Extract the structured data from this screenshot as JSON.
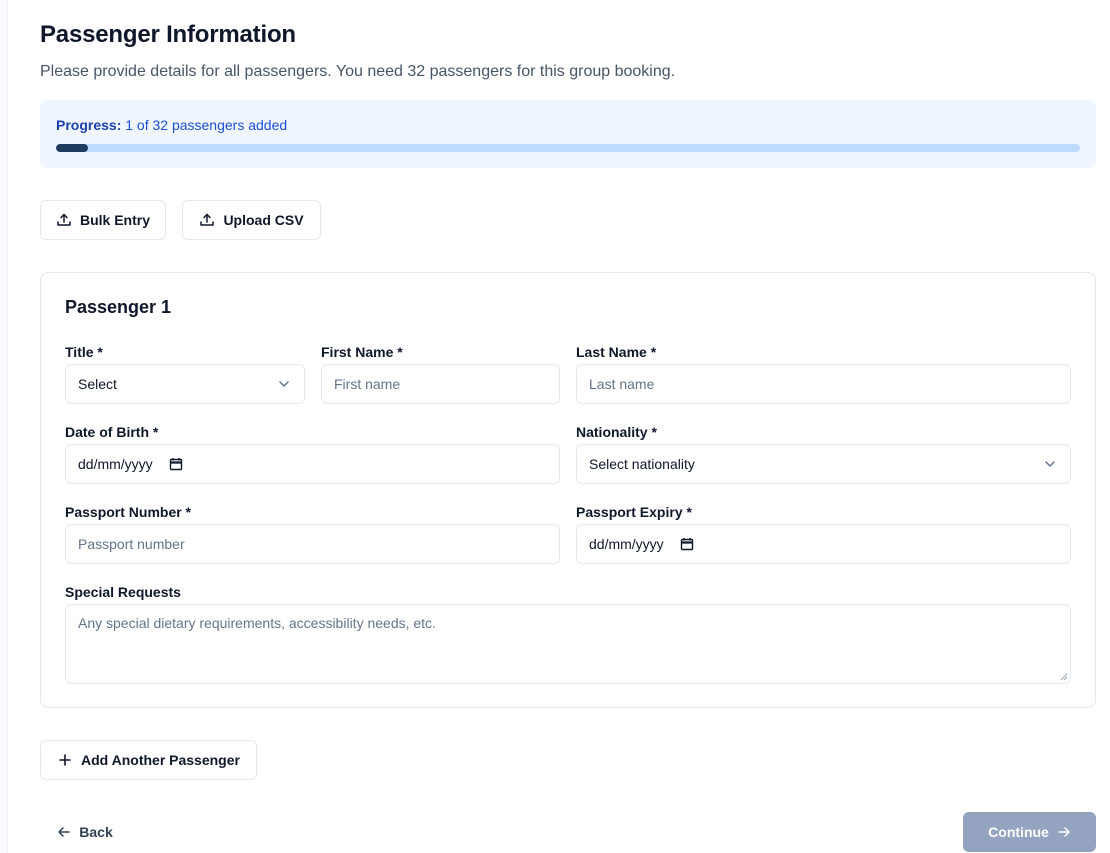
{
  "header": {
    "title": "Passenger Information",
    "subtitle": "Please provide details for all passengers. You need 32 passengers for this group booking."
  },
  "progress": {
    "label": "Progress:",
    "text": "1 of 32 passengers added",
    "added": 1,
    "total": 32
  },
  "actions": {
    "bulk_entry": "Bulk Entry",
    "upload_csv": "Upload CSV",
    "add_passenger": "Add Another Passenger",
    "back": "Back",
    "continue": "Continue"
  },
  "passenger": {
    "heading": "Passenger 1",
    "title_label": "Title *",
    "title_value": "Select",
    "first_name_label": "First Name *",
    "first_name_placeholder": "First name",
    "last_name_label": "Last Name *",
    "last_name_placeholder": "Last name",
    "dob_label": "Date of Birth *",
    "dob_value": "dd/mm/yyyy",
    "nationality_label": "Nationality *",
    "nationality_value": "Select nationality",
    "passport_label": "Passport Number *",
    "passport_placeholder": "Passport number",
    "expiry_label": "Passport Expiry *",
    "expiry_value": "dd/mm/yyyy",
    "requests_label": "Special Requests",
    "requests_placeholder": "Any special dietary requirements, accessibility needs, etc."
  },
  "icons": {
    "upload": "upload-icon",
    "plus": "plus-icon",
    "arrow_left": "arrow-left-icon",
    "arrow_right": "arrow-right-icon",
    "chevron": "chevron-down-icon",
    "calendar": "calendar-icon"
  },
  "colors": {
    "accent": "#1e3a5f",
    "progress_bg": "#eff6ff",
    "progress_track": "#bfdbfe",
    "continue_disabled": "#94a3c0"
  }
}
